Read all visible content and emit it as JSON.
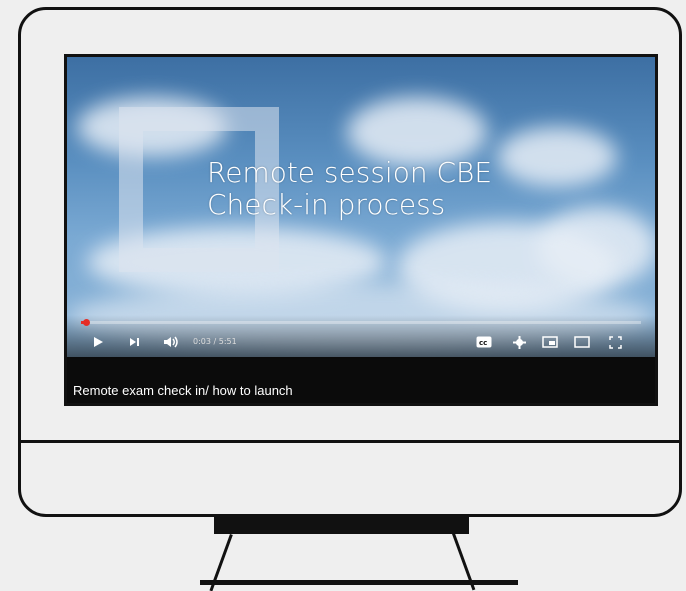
{
  "video": {
    "slide_title_line1": "Remote session CBE",
    "slide_title_line2": "Check-in process",
    "progress_fraction": 0.0087,
    "time_display": "0:03 / 5:51",
    "caption": "Remote exam check in/ how to launch"
  },
  "controls": {
    "play_icon": "play-icon",
    "next_icon": "next-icon",
    "volume_icon": "volume-icon",
    "cc_icon": "closed-captions-icon",
    "settings_icon": "gear-icon",
    "miniplayer_icon": "miniplayer-icon",
    "theater_icon": "theater-mode-icon",
    "fullscreen_icon": "fullscreen-icon"
  },
  "colors": {
    "progress": "#e52d27",
    "outline": "#111111",
    "background": "#efefef"
  }
}
